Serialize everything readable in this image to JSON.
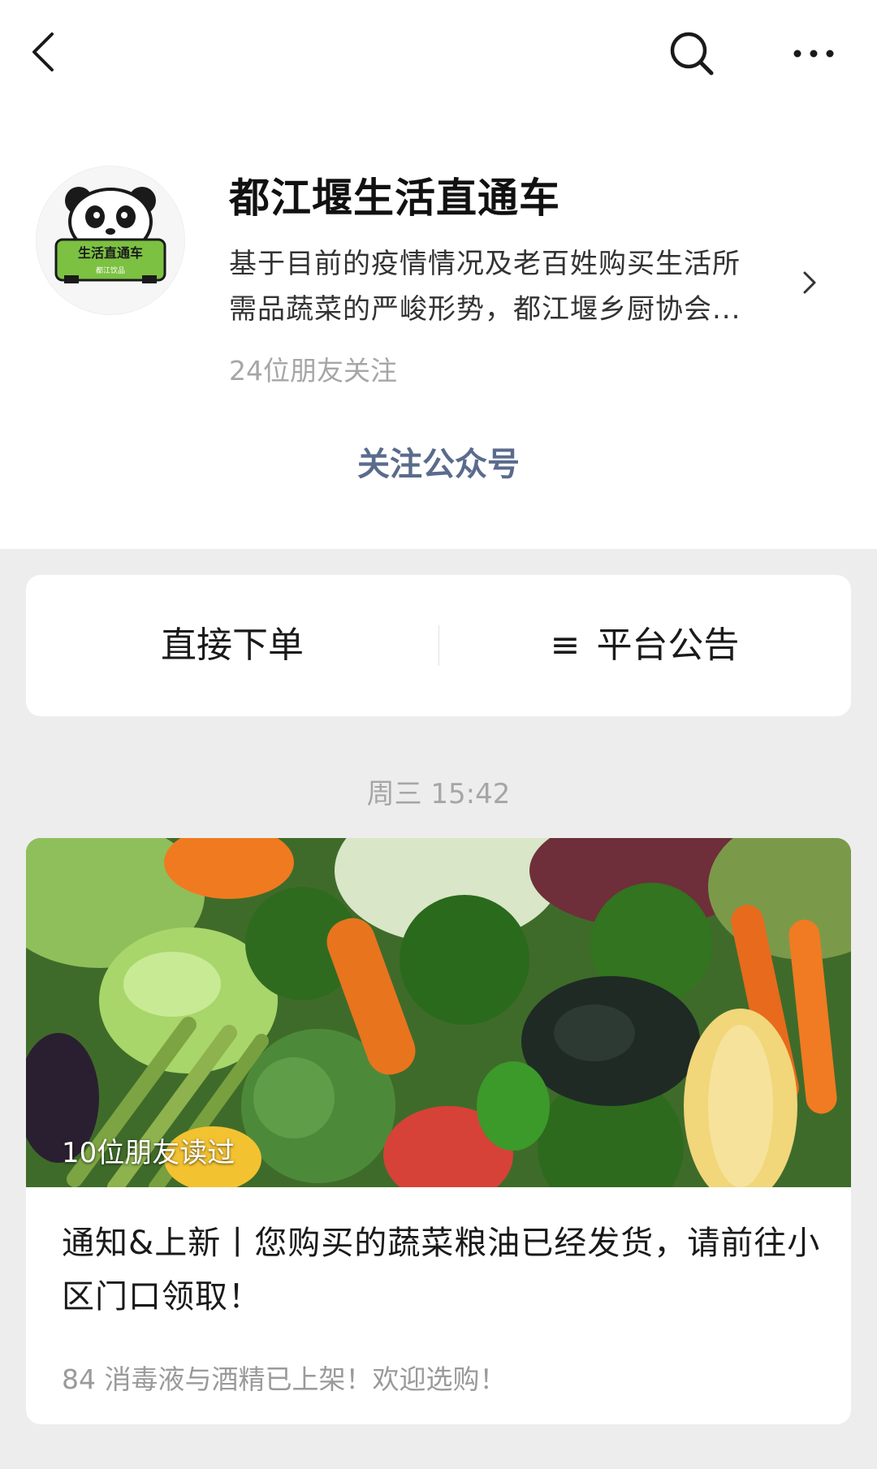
{
  "header": {
    "back_icon": "chevron-left-icon",
    "search_icon": "search-icon",
    "more_icon": "more-dots-icon"
  },
  "account": {
    "avatar_text": "生活直通车",
    "avatar_subtext": "都江饮品",
    "name": "都江堰生活直通车",
    "description_line1": "基于目前的疫情情况及老百姓购买生活所",
    "description_line2": "需品蔬菜的严峻形势，都江堰乡厨协会...",
    "followers": "24位朋友关注",
    "follow_label": "关注公众号"
  },
  "menu": {
    "left_label": "直接下单",
    "right_icon": "≡",
    "right_label": "平台公告"
  },
  "timeline": {
    "time": "周三 15:42"
  },
  "article": {
    "readers": "10位朋友读过",
    "title": "通知&上新丨您购买的蔬菜粮油已经发货，请前往小区门口领取！",
    "subtitle": "84 消毒液与酒精已上架！欢迎选购！"
  },
  "colors": {
    "background": "#ededed",
    "card": "#ffffff",
    "link_blue": "#5a6b8c",
    "muted_text": "#a6a6a6",
    "avatar_green": "#7cc142"
  }
}
